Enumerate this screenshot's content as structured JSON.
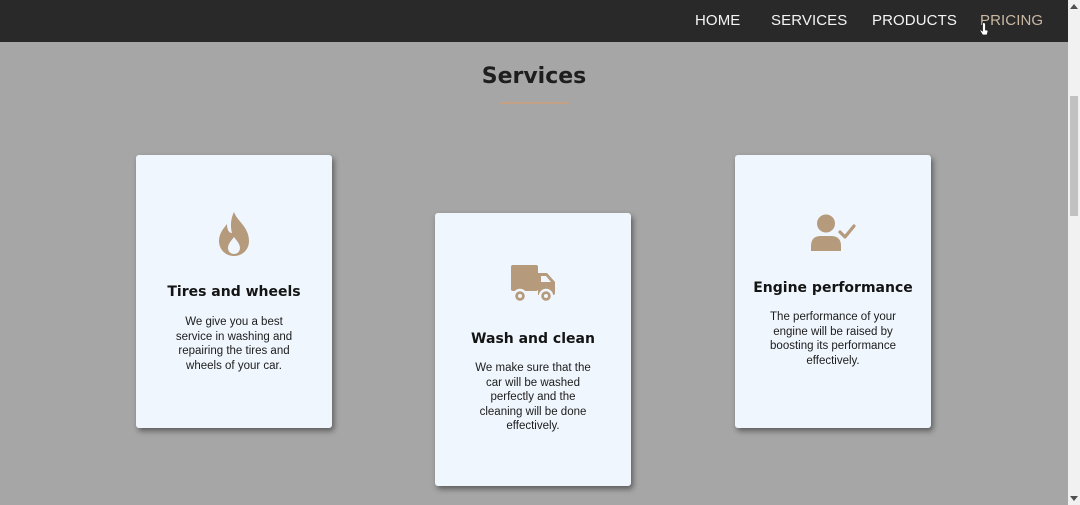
{
  "nav": {
    "links": [
      "HOME",
      "SERVICES",
      "PRODUCTS",
      "PRICING"
    ]
  },
  "section": {
    "title": "Services"
  },
  "cards": [
    {
      "icon": "fire-icon",
      "title": "Tires and wheels",
      "text_lines": [
        "We give you a best",
        "service in washing and",
        "repairing the tires and",
        "wheels of your car."
      ]
    },
    {
      "icon": "truck-icon",
      "title": "Wash and clean",
      "text_lines": [
        "We make sure that the",
        "car will be washed",
        "perfectly and the",
        "cleaning will be done",
        "effectively."
      ]
    },
    {
      "icon": "user-check-icon",
      "title": "Engine performance",
      "text_lines": [
        "The performance of your",
        "engine will be raised by",
        "boosting its performance",
        "effectively."
      ]
    }
  ],
  "colors": {
    "accent": "#c4a184",
    "icon": "#b59a7c",
    "navbar": "#292929",
    "page_bg": "#a6a6a6",
    "card_bg": "#eff6fd"
  }
}
